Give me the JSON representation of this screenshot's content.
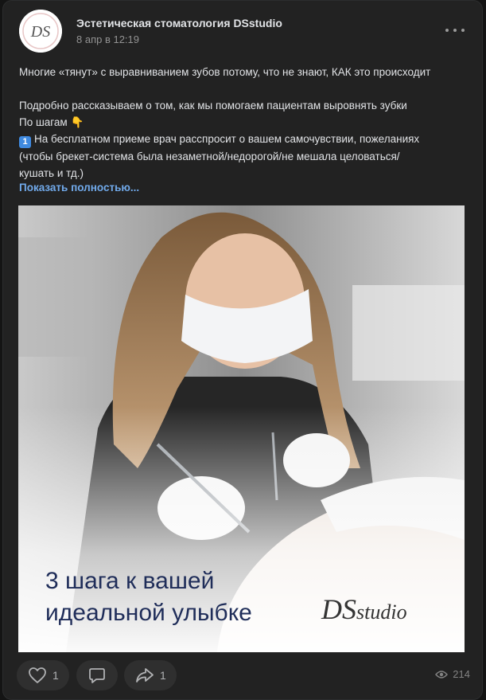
{
  "post": {
    "author": "Эстетическая стоматология DSstudio",
    "date": "8 апр в 12:19",
    "avatar_text": "DS",
    "lines": {
      "l1": "Многие «тянут» с выравниванием зубов потому, что не знают, КАК это происходит",
      "l2": "Подробно рассказываем о том, как мы помогаем пациентам выровнять зубки",
      "l3": "По шагам",
      "l3_emoji": "👇",
      "l4_num": "1",
      "l4": "На бесплатном приеме врач расспросит о вашем самочувствии, пожеланиях",
      "l5": "(чтобы брекет-система была незаметной/недорогой/не мешала целоваться/",
      "l6": "кушать и тд.)"
    },
    "show_more": "Показать полностью..."
  },
  "image": {
    "headline_1": "3 шага к вашей",
    "headline_2": "идеальной улыбке",
    "logo_ds": "DS",
    "logo_studio": "studio"
  },
  "actions": {
    "like_count": "1",
    "share_count": "1",
    "views": "214"
  },
  "icons": {
    "more": "more-horizontal-icon",
    "like": "heart-icon",
    "comment": "comment-icon",
    "share": "share-arrow-icon",
    "views": "eye-icon"
  },
  "colors": {
    "background": "#141414",
    "card": "#222222",
    "link": "#71aaeb",
    "headline": "#1f2d59",
    "logo_accent": "#c0392b"
  }
}
